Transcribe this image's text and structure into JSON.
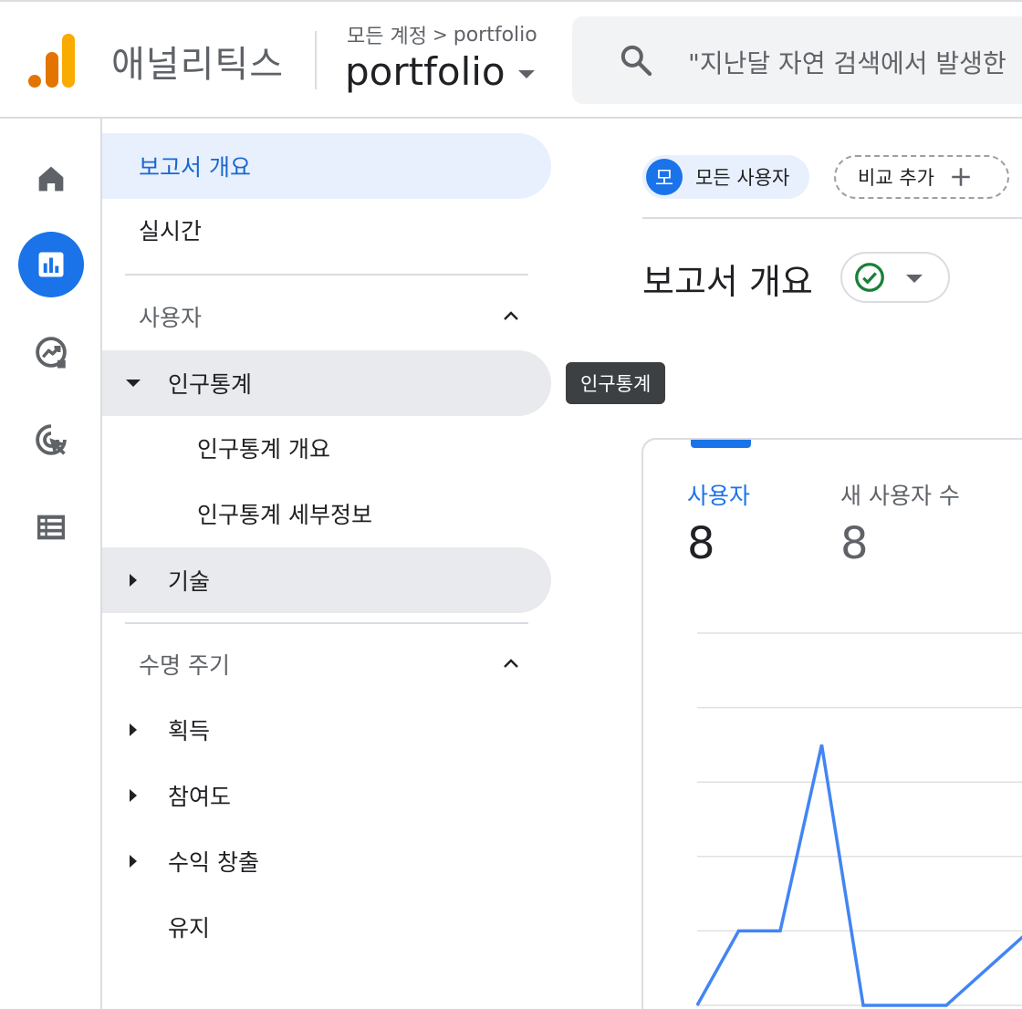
{
  "header": {
    "app_title": "애널리틱스",
    "breadcrumb": {
      "root": "모든 계정",
      "separator": ">",
      "property": "portfolio"
    },
    "property_name": "portfolio",
    "search_placeholder": "\"지난달 자연 검색에서 발생한"
  },
  "rail": {
    "items": [
      {
        "icon": "home-icon",
        "active": false
      },
      {
        "icon": "reports-icon",
        "active": true
      },
      {
        "icon": "explore-icon",
        "active": false
      },
      {
        "icon": "advertising-icon",
        "active": false
      },
      {
        "icon": "configure-icon",
        "active": false
      }
    ]
  },
  "nav": {
    "overview": "보고서 개요",
    "realtime": "실시간",
    "section_user": "사용자",
    "demographics": "인구통계",
    "demographics_overview": "인구통계 개요",
    "demographics_details": "인구통계 세부정보",
    "tech": "기술",
    "section_lifecycle": "수명 주기",
    "acquisition": "획득",
    "engagement": "참여도",
    "monetization": "수익 창출",
    "retention": "유지"
  },
  "tooltip": "인구통계",
  "main": {
    "chip_avatar": "모",
    "chip_label": "모든 사용자",
    "compare_label": "비교 추가",
    "report_title": "보고서 개요"
  },
  "card": {
    "metrics": [
      {
        "label": "사용자",
        "value": "8",
        "selected": true
      },
      {
        "label": "새 사용자 수",
        "value": "8",
        "selected": false
      }
    ]
  },
  "chart_data": {
    "type": "line",
    "title": "",
    "xlabel": "",
    "ylabel": "",
    "grid": true,
    "ylim": [
      0,
      5
    ],
    "series": [
      {
        "values": [
          0,
          1,
          1,
          3.5,
          0,
          0,
          0,
          0.5,
          1
        ]
      }
    ]
  },
  "colors": {
    "accent": "#1a73e8",
    "selected_bg": "#e8f0fe",
    "hover_bg": "#e8eaed",
    "status_green": "#188038",
    "logo_orange": "#e37400",
    "logo_yellow": "#f9ab00"
  }
}
